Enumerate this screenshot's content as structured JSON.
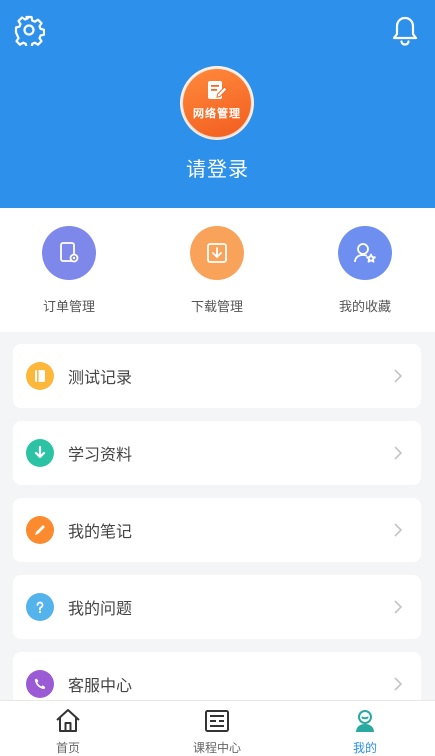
{
  "header": {
    "avatar_text": "网络管理",
    "login_label": "请登录",
    "bg_color": "#2d90ea",
    "settings_icon": "gear-icon",
    "notify_icon": "bell-icon"
  },
  "quick_actions": [
    {
      "label": "订单管理",
      "icon": "order-doc-gear-icon",
      "color": "#7e87ea"
    },
    {
      "label": "下载管理",
      "icon": "download-icon",
      "color": "#f8a25a"
    },
    {
      "label": "我的收藏",
      "icon": "user-star-icon",
      "color": "#6f8ff0"
    }
  ],
  "menu": [
    {
      "label": "测试记录",
      "icon": "notebook-icon",
      "color": "#fdb73a"
    },
    {
      "label": "学习资料",
      "icon": "download-arrow-icon",
      "color": "#2cc3a5"
    },
    {
      "label": "我的笔记",
      "icon": "pencil-icon",
      "color": "#fb8b2e"
    },
    {
      "label": "我的问题",
      "icon": "question-icon",
      "color": "#55b3ec"
    },
    {
      "label": "客服中心",
      "icon": "phone-icon",
      "color": "#9b5bd5"
    }
  ],
  "tabbar": {
    "active_color": "#2d90ea",
    "items": [
      {
        "label": "首页",
        "icon": "home-icon"
      },
      {
        "label": "课程中心",
        "icon": "course-icon"
      },
      {
        "label": "我的",
        "icon": "profile-icon",
        "active": true
      }
    ]
  }
}
